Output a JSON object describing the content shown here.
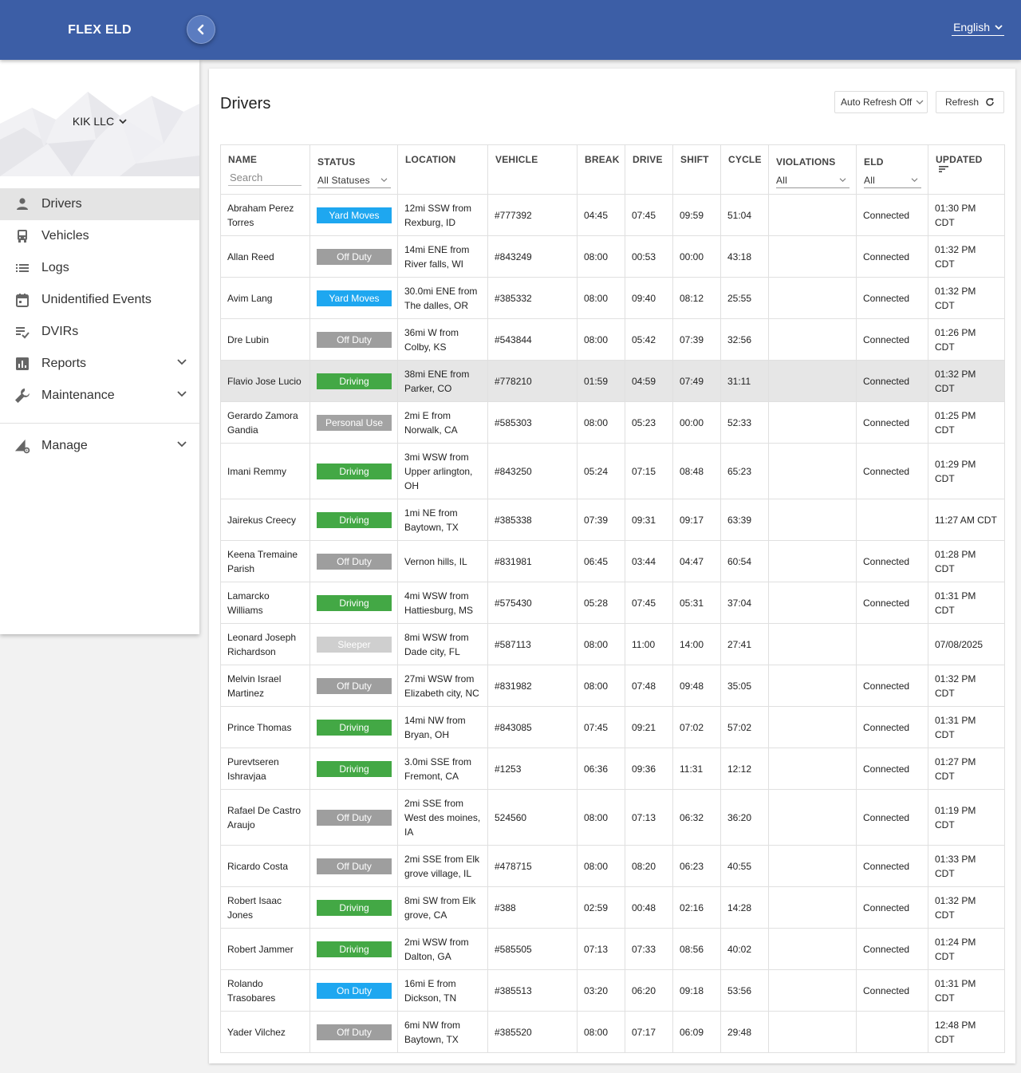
{
  "app": {
    "brand": "FLEX ELD",
    "language": "English"
  },
  "sidebar": {
    "org": "KIK LLC",
    "items": [
      {
        "label": "Drivers",
        "icon": "person-icon"
      },
      {
        "label": "Vehicles",
        "icon": "bus-icon"
      },
      {
        "label": "Logs",
        "icon": "list-icon"
      },
      {
        "label": "Unidentified Events",
        "icon": "calendar-icon"
      },
      {
        "label": "DVIRs",
        "icon": "checklist-icon"
      },
      {
        "label": "Reports",
        "icon": "bar-chart-icon"
      },
      {
        "label": "Maintenance",
        "icon": "wrench-icon"
      }
    ],
    "manage": "Manage"
  },
  "page": {
    "title": "Drivers",
    "auto_refresh": "Auto Refresh Off",
    "refresh": "Refresh"
  },
  "table": {
    "headers": {
      "name": "NAME",
      "status": "STATUS",
      "location": "LOCATION",
      "vehicle": "VEHICLE",
      "break": "BREAK",
      "drive": "DRIVE",
      "shift": "SHIFT",
      "cycle": "CYCLE",
      "violations": "VIOLATIONS",
      "eld": "ELD",
      "updated": "UPDATED"
    },
    "filters": {
      "name_placeholder": "Search",
      "status": "All Statuses",
      "violations": "All",
      "eld": "All"
    },
    "rows": [
      {
        "name": "Abraham Perez Torres",
        "status": "Yard Moves",
        "status_class": "b-yard",
        "location": "12mi SSW from Rexburg, ID",
        "vehicle": "#777392",
        "break": "04:45",
        "drive": "07:45",
        "shift": "09:59",
        "cycle": "51:04",
        "violations": "",
        "eld": "Connected",
        "updated": "01:30 PM CDT"
      },
      {
        "name": "Allan Reed",
        "status": "Off Duty",
        "status_class": "b-off",
        "location": "14mi ENE from River falls, WI",
        "vehicle": "#843249",
        "break": "08:00",
        "drive": "00:53",
        "shift": "00:00",
        "cycle": "43:18",
        "violations": "",
        "eld": "Connected",
        "updated": "01:32 PM CDT"
      },
      {
        "name": "Avim Lang",
        "status": "Yard Moves",
        "status_class": "b-yard",
        "location": "30.0mi ENE from The dalles, OR",
        "vehicle": "#385332",
        "break": "08:00",
        "drive": "09:40",
        "shift": "08:12",
        "cycle": "25:55",
        "violations": "",
        "eld": "Connected",
        "updated": "01:32 PM CDT"
      },
      {
        "name": "Dre Lubin",
        "status": "Off Duty",
        "status_class": "b-off",
        "location": "36mi W from Colby, KS",
        "vehicle": "#543844",
        "break": "08:00",
        "drive": "05:42",
        "shift": "07:39",
        "cycle": "32:56",
        "violations": "",
        "eld": "Connected",
        "updated": "01:26 PM CDT"
      },
      {
        "name": "Flavio Jose Lucio",
        "status": "Driving",
        "status_class": "b-drive",
        "location": "38mi ENE from Parker, CO",
        "vehicle": "#778210",
        "break": "01:59",
        "drive": "04:59",
        "shift": "07:49",
        "cycle": "31:11",
        "violations": "",
        "eld": "Connected",
        "updated": "01:32 PM CDT"
      },
      {
        "name": "Gerardo Zamora Gandia",
        "status": "Personal Use",
        "status_class": "b-personal",
        "location": "2mi E from Norwalk, CA",
        "vehicle": "#585303",
        "break": "08:00",
        "drive": "05:23",
        "shift": "00:00",
        "cycle": "52:33",
        "violations": "",
        "eld": "Connected",
        "updated": "01:25 PM CDT"
      },
      {
        "name": "Imani Remmy",
        "status": "Driving",
        "status_class": "b-drive",
        "location": "3mi WSW from Upper arlington, OH",
        "vehicle": "#843250",
        "break": "05:24",
        "drive": "07:15",
        "shift": "08:48",
        "cycle": "65:23",
        "violations": "",
        "eld": "Connected",
        "updated": "01:29 PM CDT"
      },
      {
        "name": "Jairekus Creecy",
        "status": "Driving",
        "status_class": "b-drive",
        "location": "1mi NE from Baytown, TX",
        "vehicle": "#385338",
        "break": "07:39",
        "drive": "09:31",
        "shift": "09:17",
        "cycle": "63:39",
        "violations": "",
        "eld": "",
        "updated": "11:27 AM CDT"
      },
      {
        "name": "Keena Tremaine Parish",
        "status": "Off Duty",
        "status_class": "b-off",
        "location": "Vernon hills, IL",
        "vehicle": "#831981",
        "break": "06:45",
        "drive": "03:44",
        "shift": "04:47",
        "cycle": "60:54",
        "violations": "",
        "eld": "Connected",
        "updated": "01:28 PM CDT"
      },
      {
        "name": "Lamarcko Williams",
        "status": "Driving",
        "status_class": "b-drive",
        "location": "4mi WSW from Hattiesburg, MS",
        "vehicle": "#575430",
        "break": "05:28",
        "drive": "07:45",
        "shift": "05:31",
        "cycle": "37:04",
        "violations": "",
        "eld": "Connected",
        "updated": "01:31 PM CDT"
      },
      {
        "name": "Leonard Joseph Richardson",
        "status": "Sleeper",
        "status_class": "b-sleeper",
        "location": "8mi WSW from Dade city, FL",
        "vehicle": "#587113",
        "break": "08:00",
        "drive": "11:00",
        "shift": "14:00",
        "cycle": "27:41",
        "violations": "",
        "eld": "",
        "updated": "07/08/2025"
      },
      {
        "name": "Melvin Israel Martinez",
        "status": "Off Duty",
        "status_class": "b-off",
        "location": "27mi WSW from Elizabeth city, NC",
        "vehicle": "#831982",
        "break": "08:00",
        "drive": "07:48",
        "shift": "09:48",
        "cycle": "35:05",
        "violations": "",
        "eld": "Connected",
        "updated": "01:32 PM CDT"
      },
      {
        "name": "Prince Thomas",
        "status": "Driving",
        "status_class": "b-drive",
        "location": "14mi NW from Bryan, OH",
        "vehicle": "#843085",
        "break": "07:45",
        "drive": "09:21",
        "shift": "07:02",
        "cycle": "57:02",
        "violations": "",
        "eld": "Connected",
        "updated": "01:31 PM CDT"
      },
      {
        "name": "Purevtseren Ishravjaa",
        "status": "Driving",
        "status_class": "b-drive",
        "location": "3.0mi SSE from Fremont, CA",
        "vehicle": "#1253",
        "break": "06:36",
        "drive": "09:36",
        "shift": "11:31",
        "cycle": "12:12",
        "violations": "",
        "eld": "Connected",
        "updated": "01:27 PM CDT"
      },
      {
        "name": "Rafael De Castro Araujo",
        "status": "Off Duty",
        "status_class": "b-off",
        "location": "2mi SSE from West des moines, IA",
        "vehicle": "524560",
        "break": "08:00",
        "drive": "07:13",
        "shift": "06:32",
        "cycle": "36:20",
        "violations": "",
        "eld": "Connected",
        "updated": "01:19 PM CDT"
      },
      {
        "name": "Ricardo Costa",
        "status": "Off Duty",
        "status_class": "b-off",
        "location": "2mi SSE from Elk grove village, IL",
        "vehicle": "#478715",
        "break": "08:00",
        "drive": "08:20",
        "shift": "06:23",
        "cycle": "40:55",
        "violations": "",
        "eld": "Connected",
        "updated": "01:33 PM CDT"
      },
      {
        "name": "Robert Isaac Jones",
        "status": "Driving",
        "status_class": "b-drive",
        "location": "8mi SW from Elk grove, CA",
        "vehicle": "#388",
        "break": "02:59",
        "drive": "00:48",
        "shift": "02:16",
        "cycle": "14:28",
        "violations": "",
        "eld": "Connected",
        "updated": "01:32 PM CDT"
      },
      {
        "name": "Robert Jammer",
        "status": "Driving",
        "status_class": "b-drive",
        "location": "2mi WSW from Dalton, GA",
        "vehicle": "#585505",
        "break": "07:13",
        "drive": "07:33",
        "shift": "08:56",
        "cycle": "40:02",
        "violations": "",
        "eld": "Connected",
        "updated": "01:24 PM CDT"
      },
      {
        "name": "Rolando Trasobares",
        "status": "On Duty",
        "status_class": "b-on",
        "location": "16mi E from Dickson, TN",
        "vehicle": "#385513",
        "break": "03:20",
        "drive": "06:20",
        "shift": "09:18",
        "cycle": "53:56",
        "violations": "",
        "eld": "Connected",
        "updated": "01:31 PM CDT"
      },
      {
        "name": "Yader Vilchez",
        "status": "Off Duty",
        "status_class": "b-off",
        "location": "6mi NW from Baytown, TX",
        "vehicle": "#385520",
        "break": "08:00",
        "drive": "07:17",
        "shift": "06:09",
        "cycle": "29:48",
        "violations": "",
        "eld": "",
        "updated": "12:48 PM CDT"
      }
    ]
  },
  "colors": {
    "header": "#3c5ea6",
    "yard_moves": "#1ea7f0",
    "off_duty": "#9e9e9e",
    "driving": "#43a845",
    "sleeper": "#cfcfcf"
  }
}
